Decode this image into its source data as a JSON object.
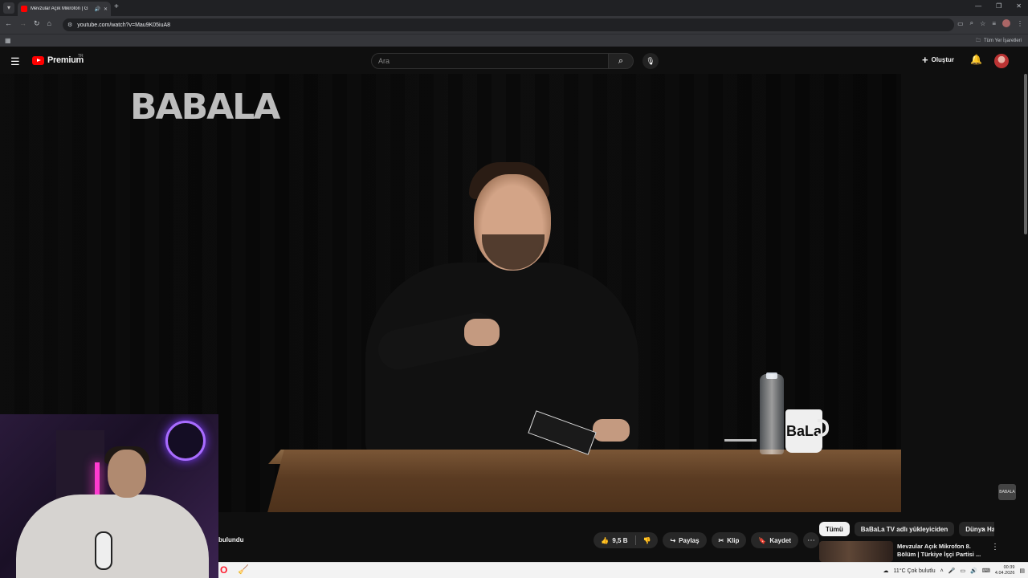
{
  "browser": {
    "tab_title": "Mevzular Açık Mikrofon | G",
    "tab_audio_icon": "speaker-icon",
    "url": "youtube.com/watch?v=Mau9K05iuA8",
    "bookmarks_label": "Tüm Yer İşaretleri"
  },
  "youtube": {
    "logo_text": "Premium",
    "logo_country": "TR",
    "search_placeholder": "Ara",
    "create_label": "Oluştur"
  },
  "video": {
    "watermark": "BABALA",
    "mug_text": "BaLa",
    "corner_badge": "BABALA"
  },
  "below_video": {
    "subscriber_fragment": "bulundu",
    "like_count": "9,5 B",
    "share_label": "Paylaş",
    "clip_label": "Klip",
    "save_label": "Kaydet"
  },
  "sidebar": {
    "chips": [
      "Tümü",
      "BaBaLa TV adlı yükleyiciden",
      "Dünya Ha"
    ],
    "active_chip": "Tümü",
    "rec_title": "Mevzular Açık Mikrofon 8. Bölüm | Türkiye İşçi Partisi ..."
  },
  "taskbar": {
    "weather": "11°C  Çok bulutlu",
    "time": "00:39",
    "date": "4.04.2026"
  },
  "colors": {
    "yt_red": "#ff0000",
    "background": "#0f0f0f",
    "chip_bg": "#272727"
  }
}
